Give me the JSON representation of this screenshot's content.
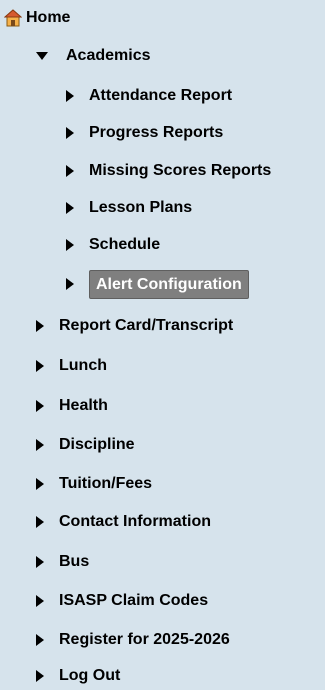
{
  "menu": {
    "home": "Home",
    "academics": {
      "label": "Academics",
      "items": [
        "Attendance Report",
        "Progress Reports",
        "Missing Scores Reports",
        "Lesson Plans",
        "Schedule",
        "Alert Configuration"
      ],
      "selected_index": 5
    },
    "items": [
      "Report Card/Transcript",
      "Lunch",
      "Health",
      "Discipline",
      "Tuition/Fees",
      "Contact Information",
      "Bus",
      "ISASP Claim Codes",
      "Register for 2025-2026",
      "Log Out"
    ]
  },
  "icons": {
    "home": "home-icon",
    "expanded": "triangle-down-icon",
    "collapsed": "triangle-right-icon"
  },
  "colors": {
    "background": "#d6e3ec",
    "selected_bg": "#7f7f7f",
    "selected_text": "#ffffff"
  }
}
